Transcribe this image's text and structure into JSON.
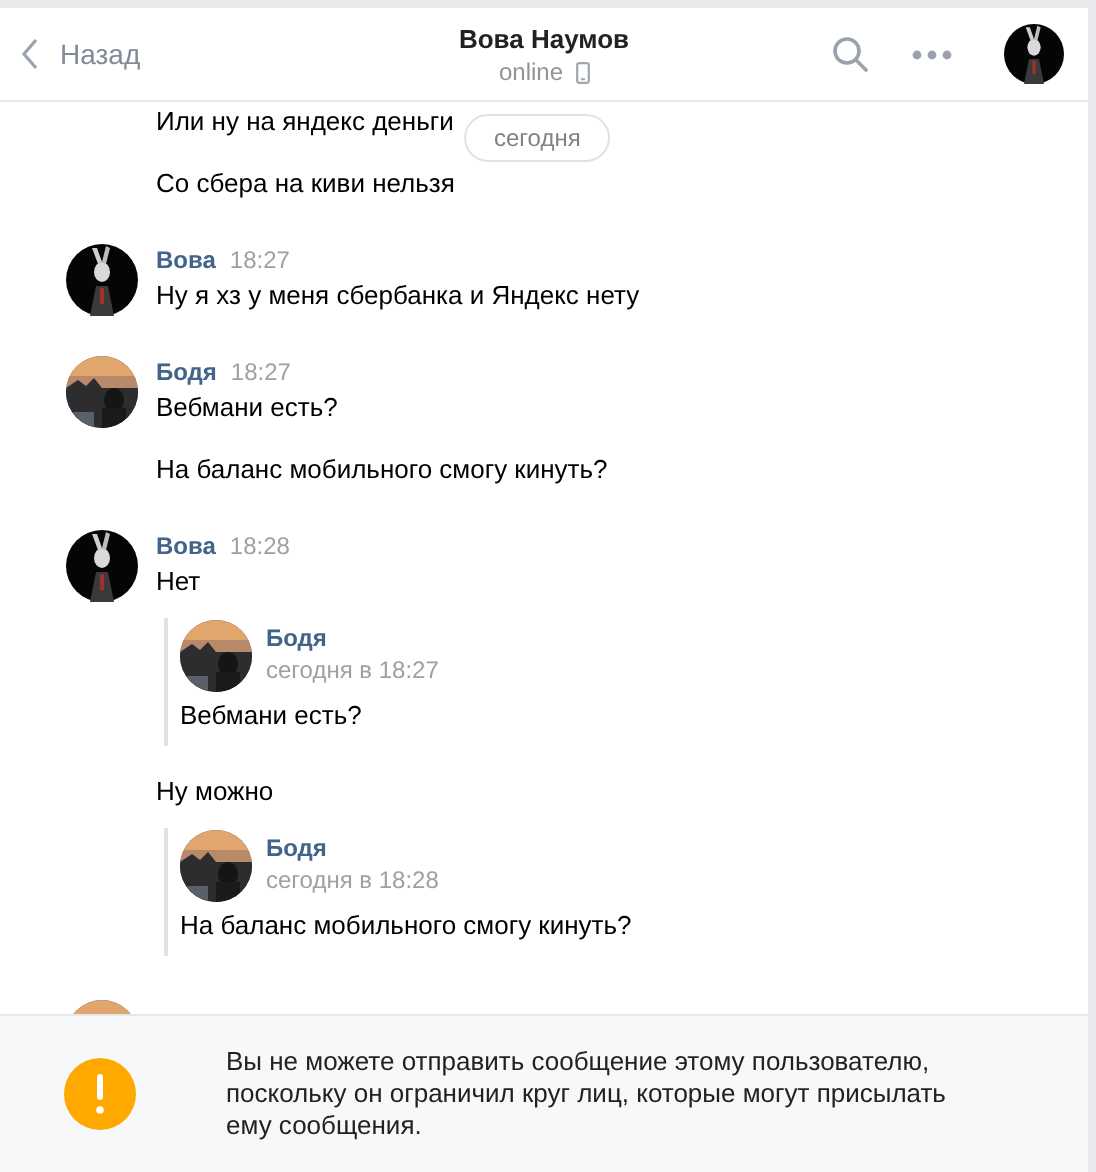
{
  "header": {
    "back_label": "Назад",
    "title": "Вова Наумов",
    "status": "online"
  },
  "date_pill": "сегодня",
  "messages": [
    {
      "items": [
        {
          "kind": "text",
          "text": "Или ну на яндекс деньги"
        },
        {
          "kind": "text",
          "text": "Со сбера на киви нельзя"
        }
      ]
    },
    {
      "avatar": {
        "kind": "picture"
      },
      "author": "Вова",
      "time": "18:27",
      "items": [
        {
          "kind": "text",
          "text": "Ну я хз у меня сбербанка и Яндекс нету"
        }
      ]
    },
    {
      "avatar": {
        "kind": "picture"
      },
      "author": "Бодя",
      "time": "18:27",
      "items": [
        {
          "kind": "text",
          "text": "Вебмани есть?"
        },
        {
          "kind": "text",
          "text": "На баланс мобильного смогу кинуть?"
        }
      ]
    },
    {
      "avatar": {
        "kind": "picture"
      },
      "author": "Вова",
      "time": "18:28",
      "items": [
        {
          "kind": "text",
          "text": "Нет"
        },
        {
          "kind": "forward",
          "author": "Бодя",
          "time": "сегодня в 18:27",
          "text": "Вебмани есть?"
        },
        {
          "kind": "text",
          "text": "Ну можно"
        },
        {
          "kind": "forward",
          "author": "Бодя",
          "time": "сегодня в 18:28",
          "text": "На баланс мобильного смогу кинуть?"
        }
      ]
    },
    {
      "avatar": {
        "kind": "picture"
      }
    }
  ],
  "notice": "Вы не можете отправить сообщение этому пользователю, поскольку он ограничил круг лиц, которые могут присылать ему сообщения."
}
